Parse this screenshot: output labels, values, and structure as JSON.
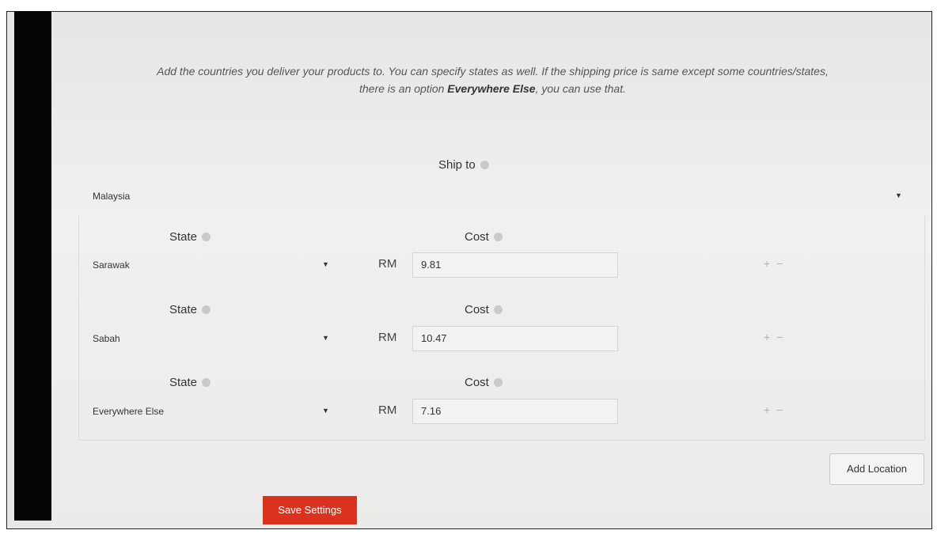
{
  "intro": {
    "line1": "Add the countries you deliver your products to. You can specify states as well. If the shipping price is same except some countries/states,",
    "line2_pre": "there is an option ",
    "line2_bold": "Everywhere Else",
    "line2_post": ", you can use that."
  },
  "ship_to": {
    "label": "Ship to",
    "country": "Malaysia"
  },
  "labels": {
    "state": "State",
    "cost": "Cost",
    "currency": "RM",
    "plus": "+",
    "minus": "−"
  },
  "locations": [
    {
      "state": "Sarawak",
      "cost": "9.81"
    },
    {
      "state": "Sabah",
      "cost": "10.47"
    },
    {
      "state": "Everywhere Else",
      "cost": "7.16"
    }
  ],
  "buttons": {
    "add_location": "Add Location",
    "save_settings": "Save Settings"
  },
  "colors": {
    "save_button": "#d9321f",
    "help_icon": "#c9c9c9"
  }
}
